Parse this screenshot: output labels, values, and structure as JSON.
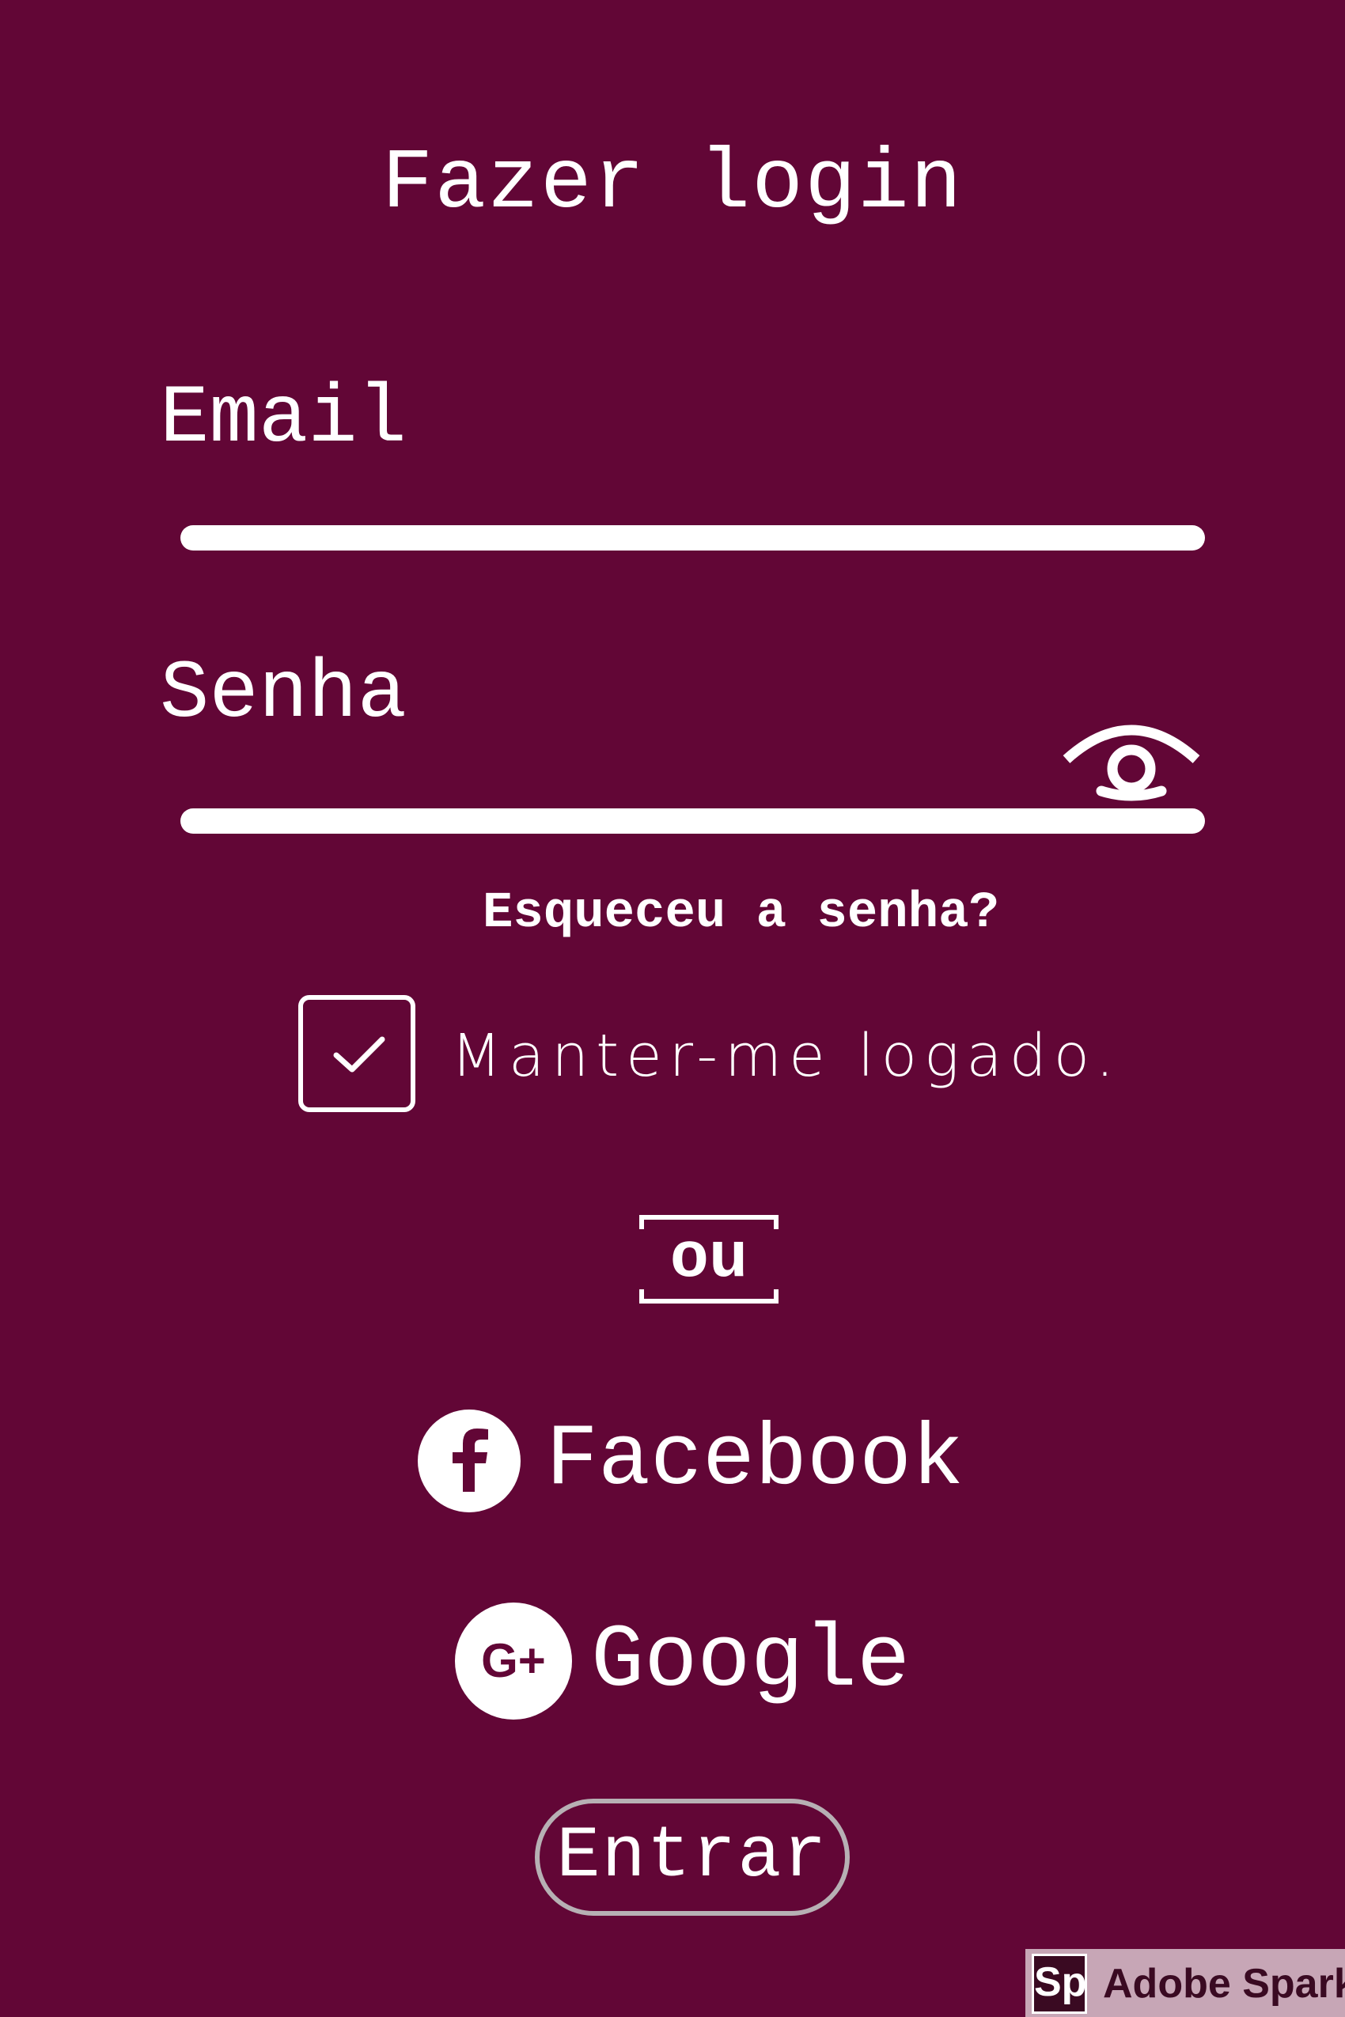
{
  "login": {
    "title": "Fazer login",
    "email_label": "Email",
    "password_label": "Senha",
    "forgot_password": "Esqueceu a senha?",
    "keep_logged_in": "Manter-me logado.",
    "keep_logged_in_checked": true,
    "separator": "ou",
    "facebook_label": "Facebook",
    "google_label": "Google",
    "google_icon_text": "G+",
    "submit_label": "Entrar"
  },
  "badge": {
    "logo_text": "Sp",
    "text": "Adobe Spark"
  },
  "icons": {
    "password_toggle": "eye-icon",
    "checkbox": "checkmark-icon",
    "facebook": "facebook-icon",
    "google": "google-plus-icon"
  },
  "colors": {
    "background": "#620636",
    "foreground": "#ffffff",
    "button_border": "#b7b0b4",
    "badge_background": "#c7a6b6",
    "badge_text": "#3a0a22"
  }
}
